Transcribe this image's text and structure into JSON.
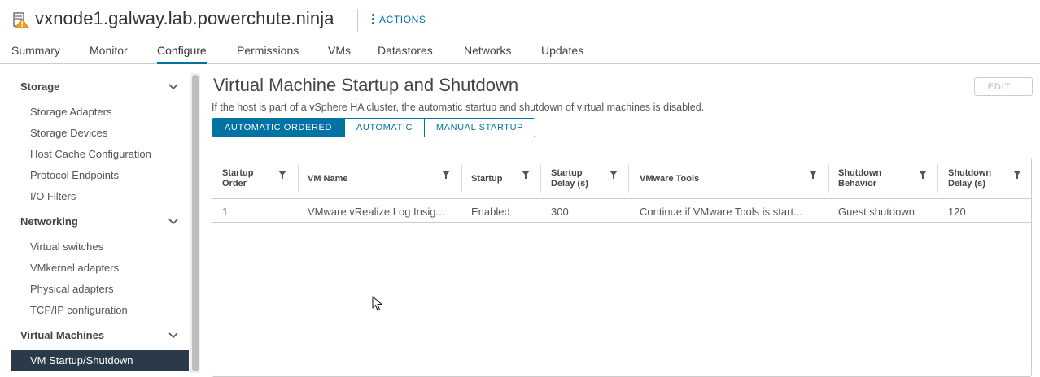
{
  "header": {
    "host_name": "vxnode1.galway.lab.powerchute.ninja",
    "actions_label": "ACTIONS",
    "host_icon": "host-warning-icon"
  },
  "tabs": [
    {
      "label": "Summary"
    },
    {
      "label": "Monitor"
    },
    {
      "label": "Configure",
      "active": true
    },
    {
      "label": "Permissions"
    },
    {
      "label": "VMs"
    },
    {
      "label": "Datastores"
    },
    {
      "label": "Networks"
    },
    {
      "label": "Updates"
    }
  ],
  "sidebar": {
    "groups": [
      {
        "label": "Storage",
        "items": [
          "Storage Adapters",
          "Storage Devices",
          "Host Cache Configuration",
          "Protocol Endpoints",
          "I/O Filters"
        ]
      },
      {
        "label": "Networking",
        "items": [
          "Virtual switches",
          "VMkernel adapters",
          "Physical adapters",
          "TCP/IP configuration"
        ]
      },
      {
        "label": "Virtual Machines",
        "items": [
          "VM Startup/Shutdown"
        ]
      }
    ],
    "selected": "VM Startup/Shutdown"
  },
  "main": {
    "title": "Virtual Machine Startup and Shutdown",
    "edit_label": "EDIT...",
    "info": "If the host is part of a vSphere HA cluster, the automatic startup and shutdown of virtual machines is disabled.",
    "modes": [
      "AUTOMATIC ORDERED",
      "AUTOMATIC",
      "MANUAL STARTUP"
    ],
    "selected_mode": "AUTOMATIC ORDERED"
  },
  "grid": {
    "columns": [
      {
        "line1": "Startup",
        "line2": "Order"
      },
      {
        "line1": "VM Name",
        "line2": ""
      },
      {
        "line1": "Startup",
        "line2": ""
      },
      {
        "line1": "Startup",
        "line2": "Delay (s)"
      },
      {
        "line1": "VMware Tools",
        "line2": ""
      },
      {
        "line1": "Shutdown",
        "line2": "Behavior"
      },
      {
        "line1": "Shutdown",
        "line2": "Delay (s)"
      }
    ],
    "rows": [
      [
        "1",
        "VMware vRealize Log Insig...",
        "Enabled",
        "300",
        "Continue if VMware Tools is start...",
        "Guest shutdown",
        "120"
      ]
    ]
  },
  "colors": {
    "accent": "#0072a3",
    "selected_nav_bg": "#2b3a49",
    "warning_icon": "#e8a31f"
  }
}
